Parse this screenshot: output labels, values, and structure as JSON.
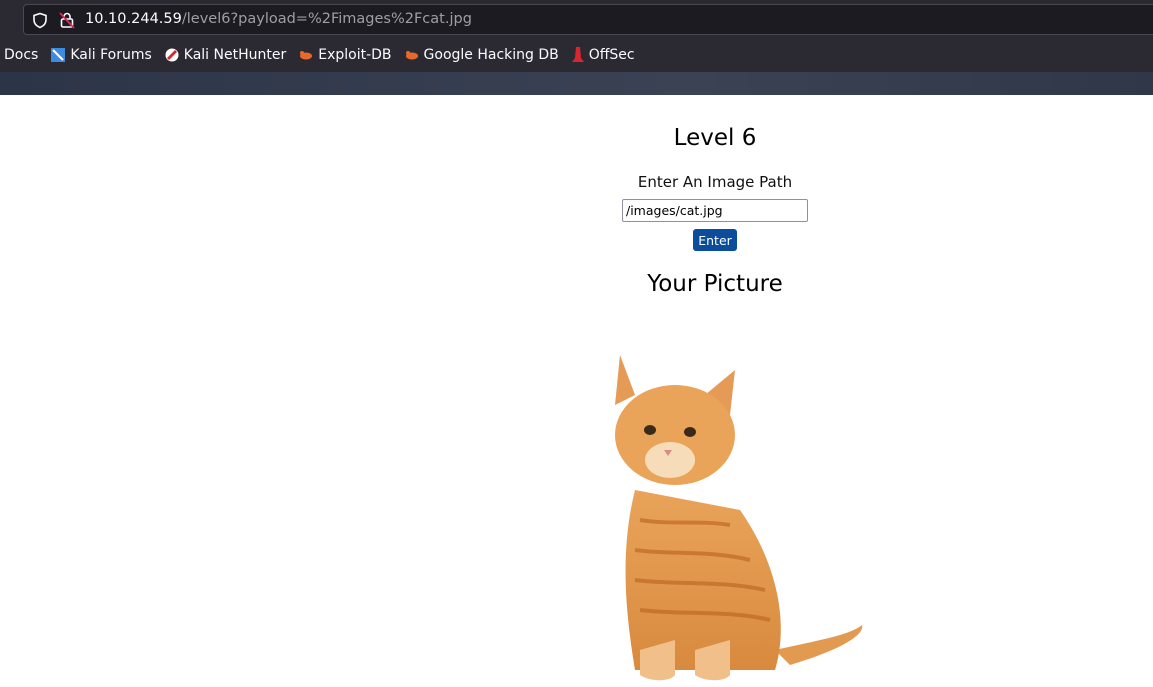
{
  "browser": {
    "url_host": "10.10.244.59",
    "url_path": "/level6?payload=%2Fimages%2Fcat.jpg",
    "bookmarks": [
      {
        "label": "Docs",
        "icon": "none"
      },
      {
        "label": "Kali Forums",
        "icon": "kali-forums-icon"
      },
      {
        "label": "Kali NetHunter",
        "icon": "nethunter-icon"
      },
      {
        "label": "Exploit-DB",
        "icon": "exploit-db-icon"
      },
      {
        "label": "Google Hacking DB",
        "icon": "ghdb-icon"
      },
      {
        "label": "OffSec",
        "icon": "offsec-icon"
      }
    ]
  },
  "page": {
    "title": "Level 6",
    "prompt": "Enter An Image Path",
    "input_value": "/images/cat.jpg",
    "button_label": "Enter",
    "picture_heading": "Your Picture",
    "accent": "#0b4d9b"
  }
}
